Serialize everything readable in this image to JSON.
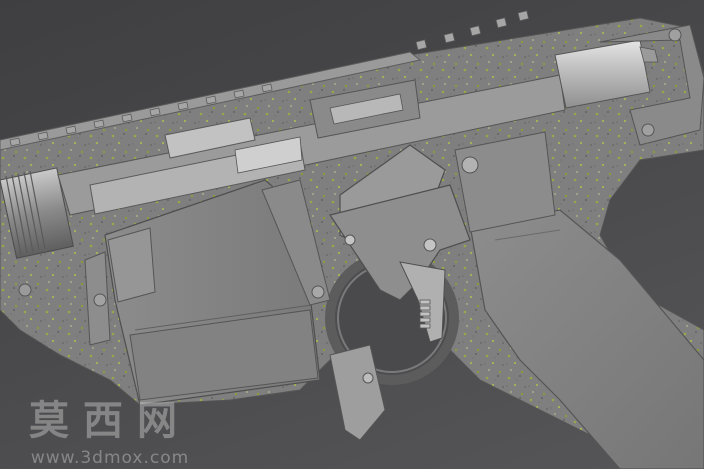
{
  "image": {
    "subject": "3D model cutaway render of a rifle lower/upper receiver with trigger group, magazine well and buffer tube",
    "background_color": "#4a4a4c",
    "body_color": "#7e7e7e",
    "speckle_colors": [
      "#9aa64a",
      "#5a5a5a",
      "#b9b98a"
    ]
  },
  "watermark": {
    "chinese": "莫西网",
    "url": "www.3dmox.com"
  }
}
